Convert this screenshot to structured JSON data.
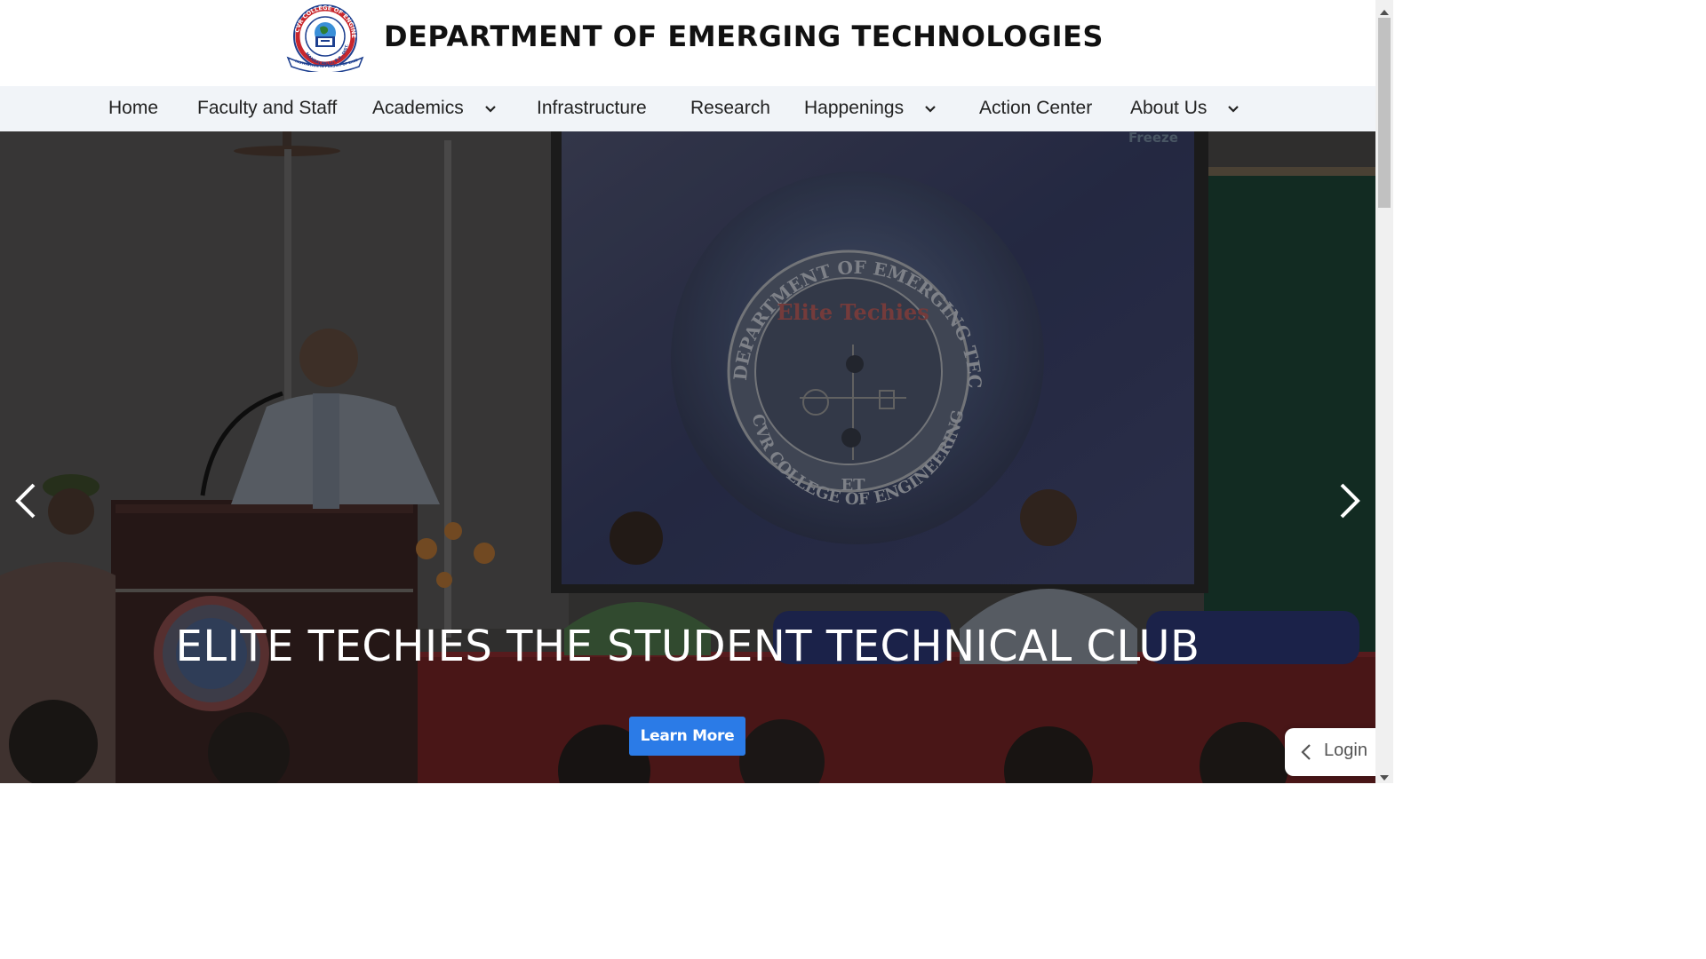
{
  "header": {
    "title": "DEPARTMENT OF EMERGING TECHNOLOGIES",
    "logo": {
      "ring_top_text": "CVR COLLEGE OF ENGINEERING",
      "ring_bottom_text": "MANGALPALLI, R.R. DIST.",
      "banner_text": "INSTITUTION IN PURSUIT OF EXCELLENCE",
      "icon": "college-crest-icon"
    }
  },
  "nav": {
    "items": [
      {
        "label": "Home",
        "has_dropdown": false
      },
      {
        "label": "Faculty and Staff",
        "has_dropdown": false
      },
      {
        "label": "Academics",
        "has_dropdown": true
      },
      {
        "label": "Infrastructure",
        "has_dropdown": false
      },
      {
        "label": "Research",
        "has_dropdown": false
      },
      {
        "label": "Happenings",
        "has_dropdown": true
      },
      {
        "label": "Action Center",
        "has_dropdown": false
      },
      {
        "label": "About Us",
        "has_dropdown": true
      }
    ]
  },
  "hero": {
    "heading": "ELITE TECHIES THE STUDENT TECHNICAL CLUB",
    "cta_label": "Learn More",
    "screen_logo": {
      "ring_text": "DEPARTMENT OF EMERGING TECHNOLOGIES",
      "ring_bottom_text": "CVR COLLEGE OF ENGINEERING",
      "center_text": "Elite Techies",
      "badge": "ET"
    },
    "screen_corner_text": "Freeze",
    "prev_icon": "chevron-left-icon",
    "next_icon": "chevron-right-icon"
  },
  "login": {
    "label": "Login",
    "icon": "chevron-left-icon"
  },
  "colors": {
    "nav_bg": "#f1f4f8",
    "button_blue": "#2b7be7",
    "title_text": "#111111"
  }
}
